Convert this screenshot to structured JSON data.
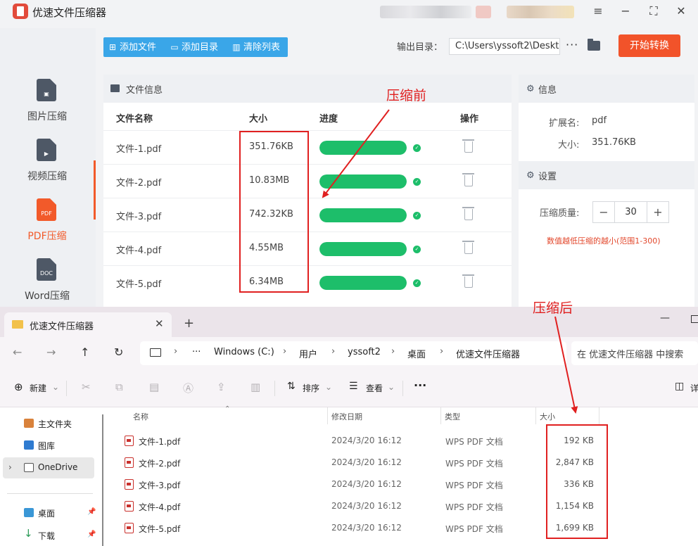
{
  "app": {
    "title": "优速文件压缩器",
    "sidebar": [
      {
        "label": "图片压缩",
        "glyph": "▣",
        "active": false
      },
      {
        "label": "视频压缩",
        "glyph": "▶",
        "active": false
      },
      {
        "label": "PDF压缩",
        "glyph": "PDF",
        "active": true
      },
      {
        "label": "Word压缩",
        "glyph": "DOC",
        "active": false
      }
    ],
    "toolbar": {
      "add_file": "添加文件",
      "add_dir": "添加目录",
      "clear_list": "清除列表"
    },
    "output": {
      "label": "输出目录：",
      "path": "C:\\Users\\yssoft2\\Deskt",
      "more": "···"
    },
    "start_button": "开始转换",
    "file_panel": {
      "title": "文件信息",
      "columns": {
        "name": "文件名称",
        "size": "大小",
        "progress": "进度",
        "action": "操作"
      },
      "rows": [
        {
          "name": "文件-1.pdf",
          "size": "351.76KB",
          "progress": 1.0
        },
        {
          "name": "文件-2.pdf",
          "size": "10.83MB",
          "progress": 1.0
        },
        {
          "name": "文件-3.pdf",
          "size": "742.32KB",
          "progress": 1.0
        },
        {
          "name": "文件-4.pdf",
          "size": "4.55MB",
          "progress": 1.0
        },
        {
          "name": "文件-5.pdf",
          "size": "6.34MB",
          "progress": 1.0
        }
      ]
    },
    "info_panel": {
      "title": "信息",
      "ext_label": "扩展名:",
      "ext_value": "pdf",
      "size_label": "大小:",
      "size_value": "351.76KB",
      "settings_title": "设置",
      "quality_label": "压缩质量:",
      "quality_value": "30",
      "minus": "−",
      "plus": "+",
      "hint": "数值越低压缩的越小(范围1-300)"
    }
  },
  "explorer": {
    "tab_title": "优速文件压缩器",
    "breadcrumb": [
      "Windows (C:)",
      "用户",
      "yssoft2",
      "桌面",
      "优速文件压缩器"
    ],
    "breadcrumb_more": "···",
    "search_placeholder": "在 优速文件压缩器 中搜索",
    "commands": {
      "new": "新建",
      "sort": "排序",
      "view": "查看",
      "more": "···",
      "details": "详"
    },
    "nav": [
      {
        "label": "主文件夹",
        "pinned": false
      },
      {
        "label": "图库",
        "pinned": false
      },
      {
        "label": "OneDrive",
        "pinned": false
      },
      {
        "label": "桌面",
        "pinned": true
      },
      {
        "label": "下载",
        "pinned": true
      }
    ],
    "columns": {
      "name": "名称",
      "modified": "修改日期",
      "type": "类型",
      "size": "大小"
    },
    "files": [
      {
        "name": "文件-1.pdf",
        "modified": "2024/3/20 16:12",
        "type": "WPS PDF 文档",
        "size": "192 KB"
      },
      {
        "name": "文件-2.pdf",
        "modified": "2024/3/20 16:12",
        "type": "WPS PDF 文档",
        "size": "2,847 KB"
      },
      {
        "name": "文件-3.pdf",
        "modified": "2024/3/20 16:12",
        "type": "WPS PDF 文档",
        "size": "336 KB"
      },
      {
        "name": "文件-4.pdf",
        "modified": "2024/3/20 16:12",
        "type": "WPS PDF 文档",
        "size": "1,154 KB"
      },
      {
        "name": "文件-5.pdf",
        "modified": "2024/3/20 16:12",
        "type": "WPS PDF 文档",
        "size": "1,699 KB"
      }
    ]
  },
  "annotations": {
    "before": "压缩前",
    "after": "压缩后",
    "color": "#e02020"
  },
  "colors": {
    "accent": "#f2532a",
    "toolbar": "#3aa6e8",
    "progress": "#1dbe6a"
  }
}
